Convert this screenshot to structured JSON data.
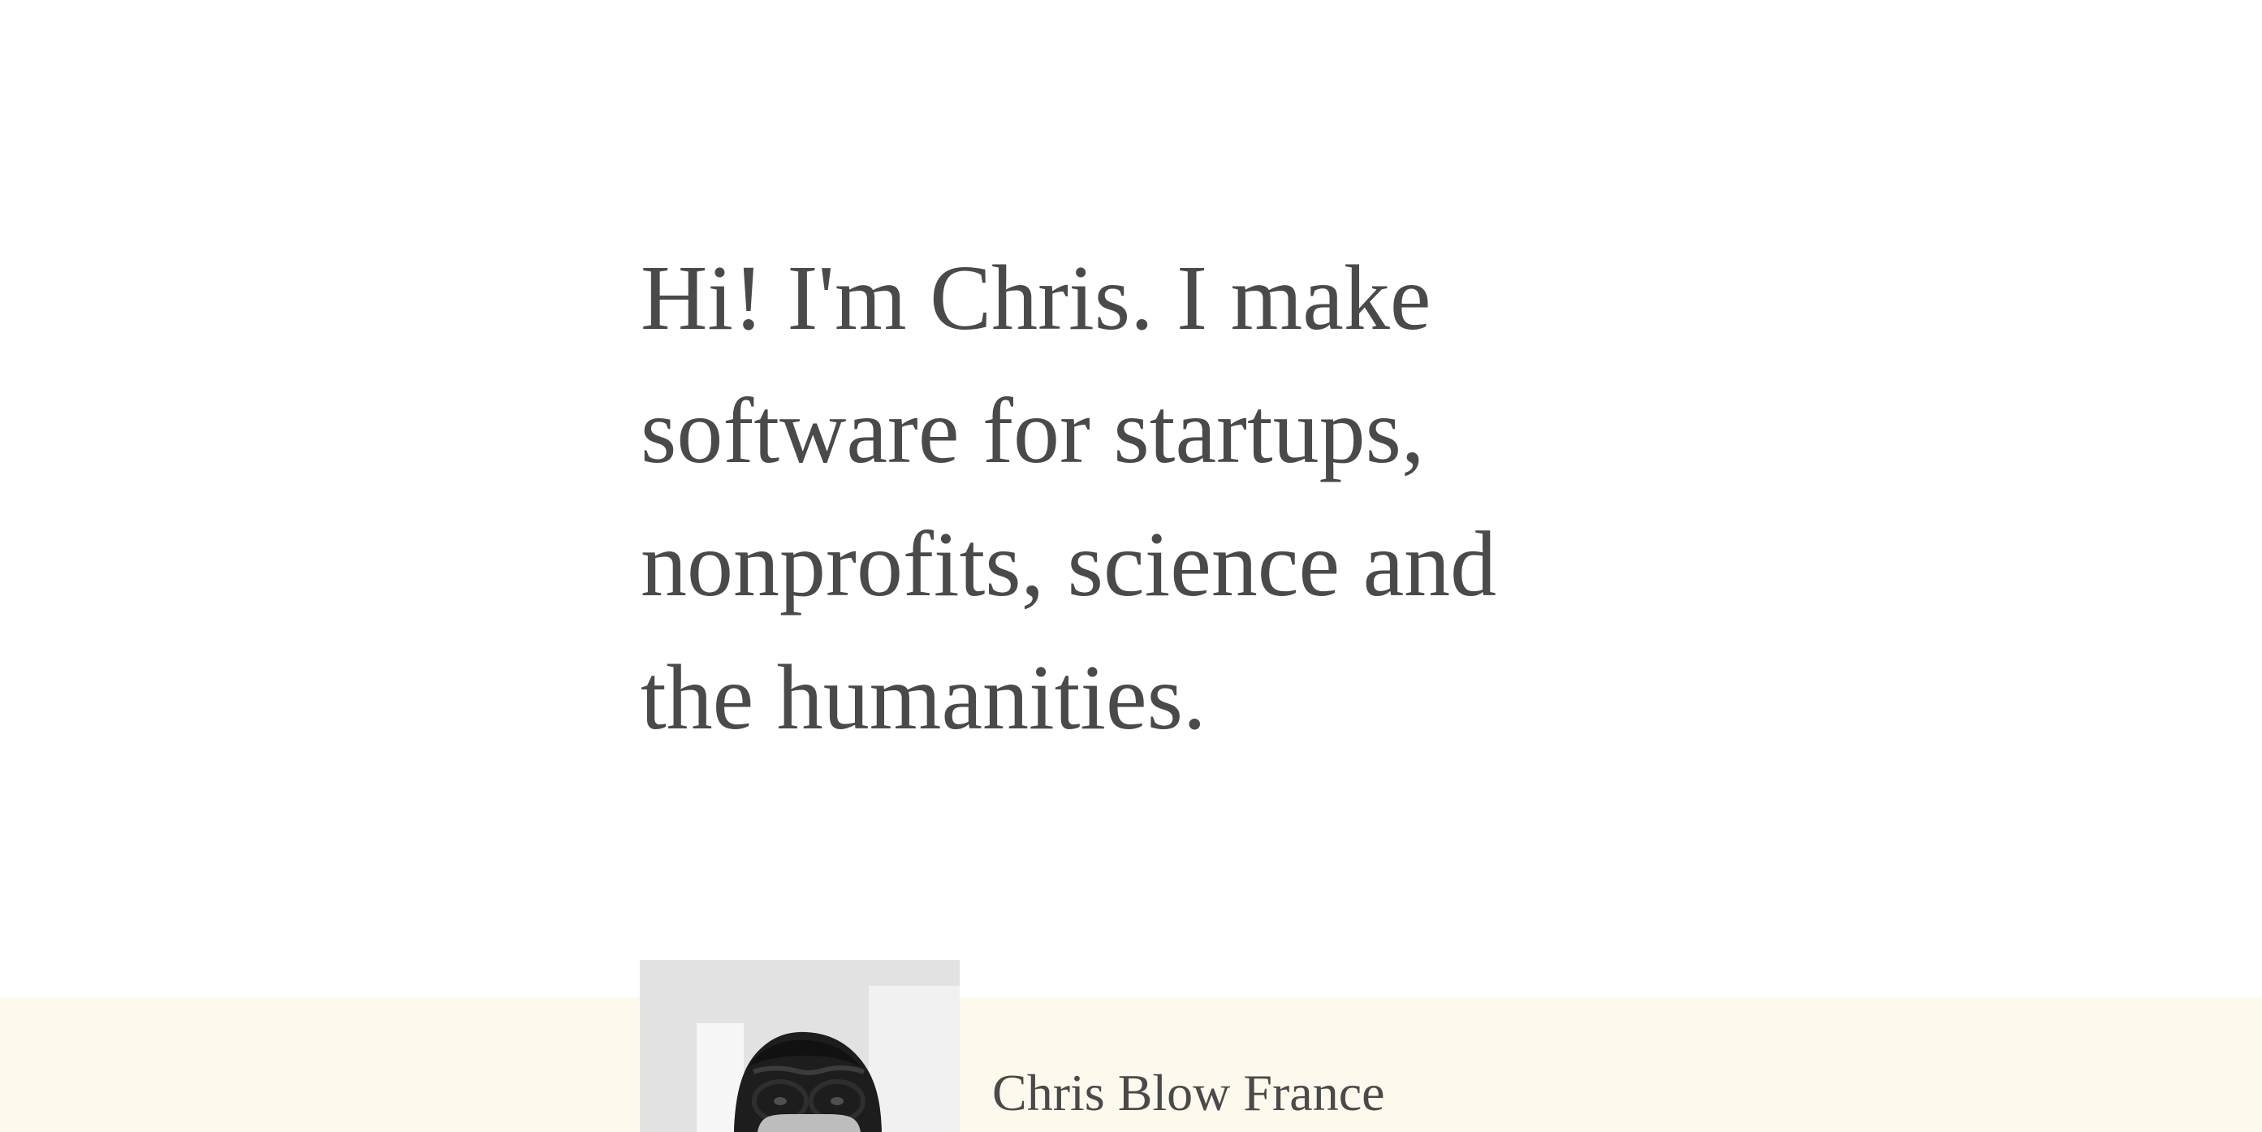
{
  "hero": {
    "headline": "Hi! I'm Chris. I make software for startups, nonprofits, science and the humanities."
  },
  "profile": {
    "name": "Chris Blow France",
    "photo_icon": "portrait-photo"
  },
  "colors": {
    "text": "#4a4a4a",
    "band_background": "#fdf9ed",
    "page_background": "#ffffff"
  }
}
